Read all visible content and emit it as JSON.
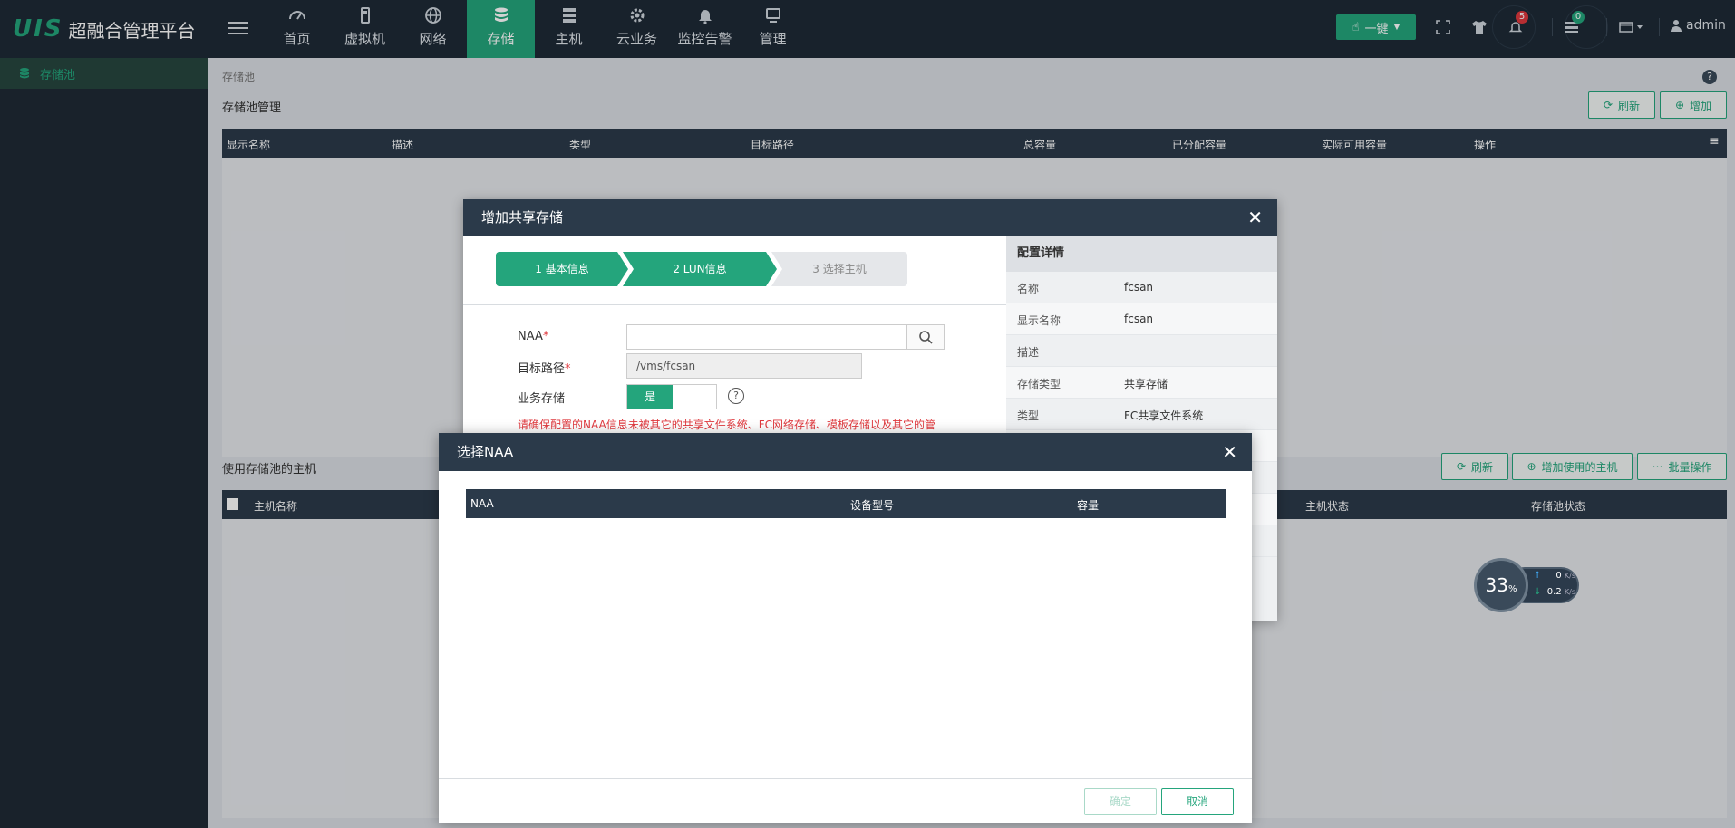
{
  "app": {
    "logo": "UIS",
    "title": "超融合管理平台"
  },
  "nav": [
    {
      "label": "首页",
      "icon": "dashboard-icon"
    },
    {
      "label": "虚拟机",
      "icon": "vm-icon"
    },
    {
      "label": "网络",
      "icon": "globe-icon"
    },
    {
      "label": "存储",
      "icon": "database-icon",
      "active": true
    },
    {
      "label": "主机",
      "icon": "server-icon"
    },
    {
      "label": "云业务",
      "icon": "gear-icon"
    },
    {
      "label": "监控告警",
      "icon": "bell-icon"
    },
    {
      "label": "管理",
      "icon": "monitor-icon"
    }
  ],
  "topbar": {
    "onekey": "一键",
    "alerts_count": "5",
    "tasks_count": "0",
    "user": "admin"
  },
  "sidebar": {
    "items": [
      {
        "label": "存储池"
      }
    ]
  },
  "main": {
    "breadcrumb": "存储池",
    "pool_section": "存储池管理",
    "refresh": "刷新",
    "add": "增加",
    "pool_columns": [
      "显示名称",
      "描述",
      "类型",
      "目标路径",
      "总容量",
      "已分配容量",
      "实际可用容量",
      "操作"
    ],
    "host_section": "使用存储池的主机",
    "add_host": "增加使用的主机",
    "batch": "批量操作",
    "host_columns": [
      "主机名称",
      "主机状态",
      "存储池状态"
    ]
  },
  "dialog_add": {
    "title": "增加共享存储",
    "steps": [
      "1 基本信息",
      "2 LUN信息",
      "3 选择主机"
    ],
    "naa_label": "NAA",
    "path_label": "目标路径",
    "path_value": "/vms/fcsan",
    "business_label": "业务存储",
    "toggle_on": "是",
    "warning": "请确保配置的NAA信息未被其它的共享文件系统、FC网络存储、模板存储以及其它的管",
    "details_title": "配置详情",
    "details": [
      {
        "k": "名称",
        "v": "fcsan"
      },
      {
        "k": "显示名称",
        "v": "fcsan"
      },
      {
        "k": "描述",
        "v": ""
      },
      {
        "k": "存储类型",
        "v": "共享存储"
      },
      {
        "k": "类型",
        "v": "FC共享文件系统"
      }
    ]
  },
  "dialog_naa": {
    "title": "选择NAA",
    "columns": [
      "NAA",
      "设备型号",
      "容量"
    ],
    "ok": "确定",
    "cancel": "取消"
  },
  "speed": {
    "percent": "33",
    "percent_unit": "%",
    "up": "0",
    "down": "0.2",
    "unit": "K/s"
  },
  "colors": {
    "accent": "#24a57c",
    "header": "#1e2a36",
    "table_head": "#2b3a4a",
    "warn": "#e0393e"
  }
}
